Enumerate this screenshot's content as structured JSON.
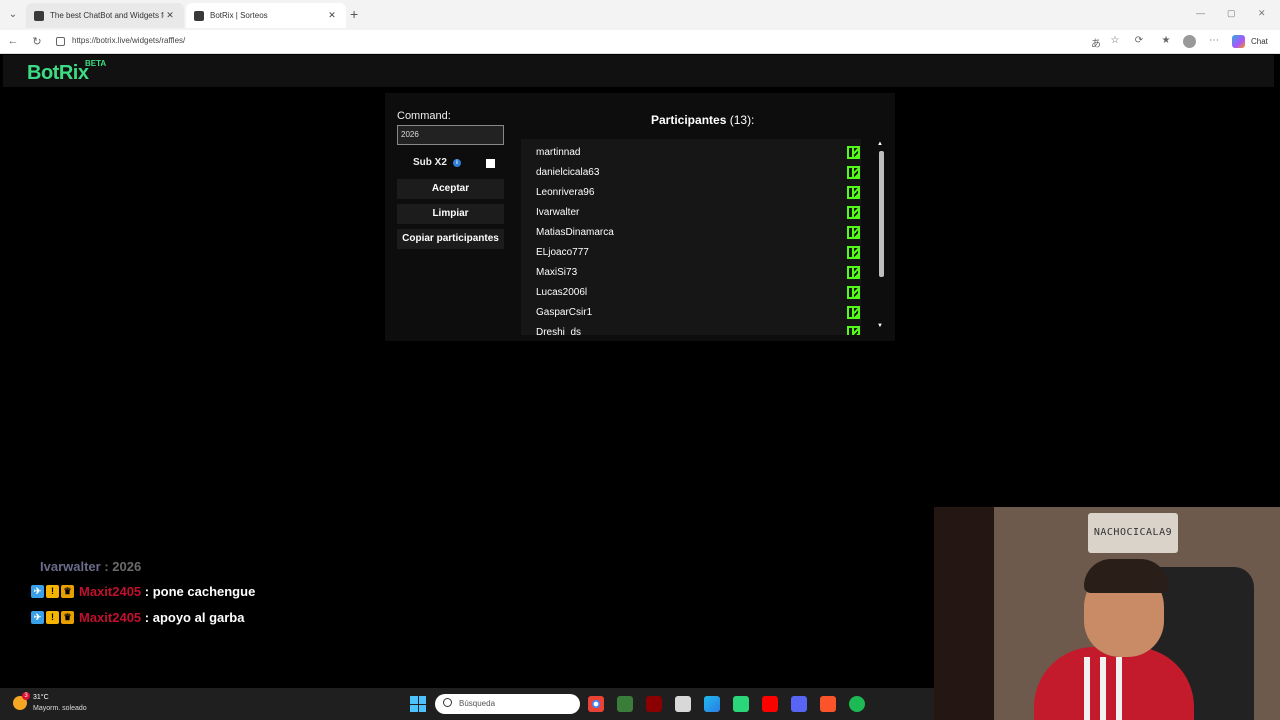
{
  "browser": {
    "tabs": [
      {
        "title": "The best ChatBot and Widgets for"
      },
      {
        "title": "BotRix | Sorteos"
      }
    ],
    "url": "https://botrix.live/widgets/raffles/",
    "chat_label": "Chat"
  },
  "app": {
    "logo": "BotRix",
    "logo_tag": "BETA"
  },
  "raffle": {
    "command_label": "Command:",
    "command_value": "2026",
    "sub_label": "Sub X2",
    "accept_label": "Aceptar",
    "clear_label": "Limpiar",
    "copy_label": "Copiar participantes",
    "participants_label": "Participantes",
    "participants_count": "(13):",
    "participants": [
      "martinnad",
      "danielcicala63",
      "Leonrivera96",
      "Ivarwalter",
      "MatiasDinamarca",
      "ELjoaco777",
      "MaxiSi73",
      "Lucas2006l",
      "GasparCsir1",
      "Dreshi_ds"
    ]
  },
  "chat": [
    {
      "user": "Ivarwalter",
      "sep": " : ",
      "msg": "2026",
      "user_color": "#6b6b8a",
      "msg_color": "#6b6b6b"
    },
    {
      "user": "Maxit2405",
      "sep": " : ",
      "msg": "pone cachengue",
      "user_color": "#c0102e",
      "msg_color": "#ffffff"
    },
    {
      "user": "Maxit2405",
      "sep": " : ",
      "msg": "apoyo al garba",
      "user_color": "#c0102e",
      "msg_color": "#ffffff"
    }
  ],
  "webcam": {
    "sign_text": "NACHOCICALA9"
  },
  "taskbar": {
    "temperature": "31°C",
    "condition": "Mayorm. soleado",
    "weather_badge": "3",
    "search_placeholder": "Búsqueda"
  },
  "colors": {
    "brand": "#3ddc84",
    "kick": "#53fc18"
  }
}
